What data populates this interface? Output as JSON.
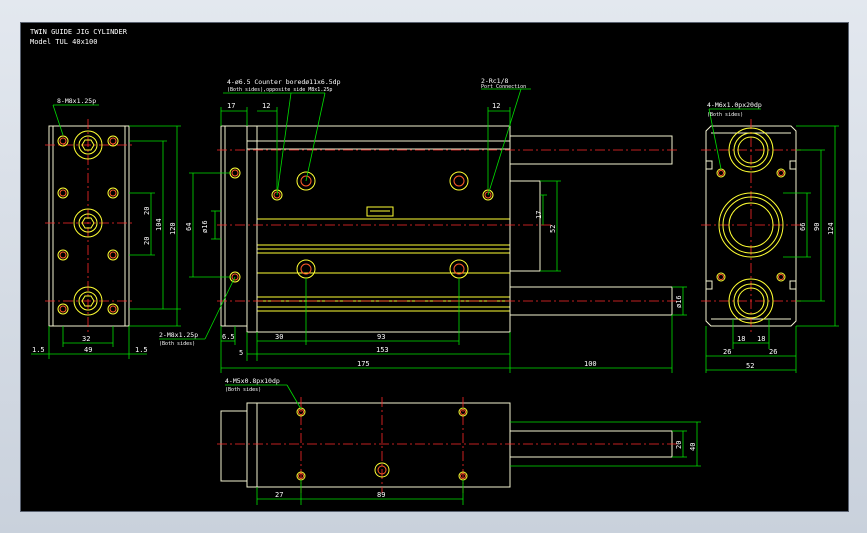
{
  "title": {
    "line1": "TWIN GUIDE JIG CYLINDER",
    "line2": "Model  TUL 40x100"
  },
  "colors": {
    "background": "#000000",
    "object": "#f2f2d0",
    "yellow": "#ffff33",
    "dimension": "#00e000",
    "centerline": "#ff2a2a",
    "text": "#ffffff"
  },
  "left_view": {
    "callout": "8-M8x1.25p",
    "dims": {
      "top_width": "32",
      "overall_width": "49",
      "left_edge": "1.5",
      "right_edge": "1.5",
      "pitch_a": "20",
      "pitch_b": "20",
      "height_a": "104",
      "height_b": "120"
    }
  },
  "front_view": {
    "callouts": {
      "counterbore": "4-ø6.5  Counter boredø11x6.5dp",
      "counterbore_sub": "(Both sides),opposite side M8x1.25p",
      "port": "2-Rc1/8",
      "port_sub": "Port Connection",
      "tapped": "2-M8x1.25p",
      "tapped_sub": "(Both sides)"
    },
    "dims": {
      "top_17": "17",
      "top_12a": "12",
      "top_12b": "12",
      "d64": "64",
      "d16": "ø16",
      "d6_5": "6.5",
      "d5": "5",
      "d30": "30",
      "d93": "93",
      "d153": "153",
      "d175": "175",
      "d100": "100",
      "d17r": "17",
      "d52r": "52",
      "d16r": "ø16"
    }
  },
  "right_view": {
    "callout": "4-M6x1.0px20dp",
    "callout_sub": "(Both sides)",
    "dims": {
      "d18a": "18",
      "d18b": "18",
      "d26a": "26",
      "d26b": "26",
      "d52": "52",
      "d66": "66",
      "d90": "90",
      "d124": "124"
    }
  },
  "bottom_view": {
    "callout": "4-M5x0.8px10dp",
    "callout_sub": "(Both sides)",
    "dims": {
      "d27": "27",
      "d89": "89",
      "d20": "20",
      "d40": "40"
    }
  }
}
